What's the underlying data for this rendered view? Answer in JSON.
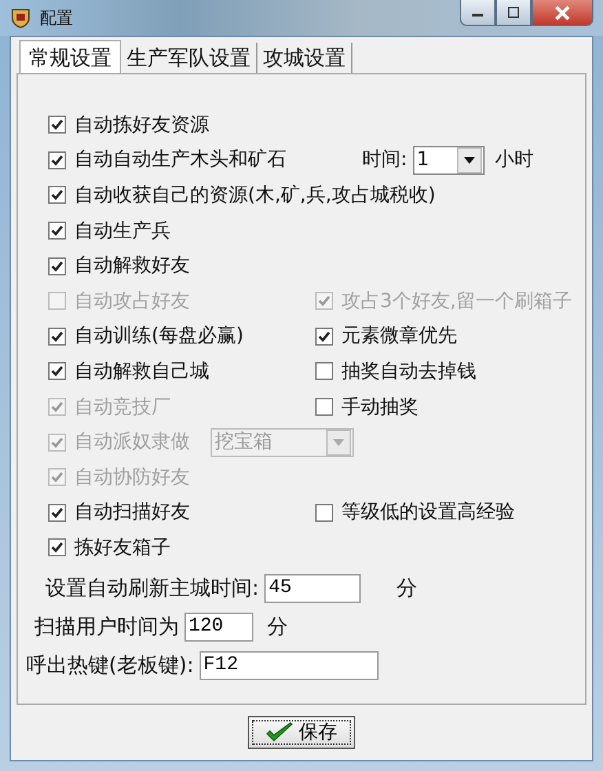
{
  "window": {
    "title": "配置"
  },
  "tabs": [
    {
      "label": "常规设置",
      "selected": true
    },
    {
      "label": "生产军队设置",
      "selected": false
    },
    {
      "label": "攻城设置",
      "selected": false
    }
  ],
  "rows": [
    {
      "items": [
        {
          "kind": "checkbox",
          "label": "自动拣好友资源",
          "checked": true,
          "disabled": false
        }
      ]
    },
    {
      "items": [
        {
          "kind": "checkbox",
          "label": "自动自动生产木头和矿石",
          "checked": true,
          "disabled": false
        },
        {
          "kind": "label",
          "label": "时间:"
        },
        {
          "kind": "select",
          "value": "1",
          "disabled": false
        },
        {
          "kind": "unit",
          "label": "小时"
        }
      ]
    },
    {
      "items": [
        {
          "kind": "checkbox",
          "label": "自动收获自己的资源(木,矿,兵,攻占城税收)",
          "checked": true,
          "disabled": false
        }
      ]
    },
    {
      "items": [
        {
          "kind": "checkbox",
          "label": "自动生产兵",
          "checked": true,
          "disabled": false
        }
      ]
    },
    {
      "items": [
        {
          "kind": "checkbox",
          "label": "自动解救好友",
          "checked": true,
          "disabled": false
        }
      ]
    },
    {
      "items": [
        {
          "kind": "checkbox",
          "label": "自动攻占好友",
          "checked": false,
          "disabled": true
        },
        {
          "kind": "checkbox",
          "label": "攻占3个好友,留一个刷箱子",
          "checked": true,
          "disabled": true
        }
      ]
    },
    {
      "items": [
        {
          "kind": "checkbox",
          "label": "自动训练(每盘必赢)",
          "checked": true,
          "disabled": false
        },
        {
          "kind": "checkbox",
          "label": "元素微章优先",
          "checked": true,
          "disabled": false
        }
      ]
    },
    {
      "items": [
        {
          "kind": "checkbox",
          "label": "自动解救自己城",
          "checked": true,
          "disabled": false
        },
        {
          "kind": "checkbox",
          "label": "抽奖自动去掉钱",
          "checked": false,
          "disabled": false
        }
      ]
    },
    {
      "items": [
        {
          "kind": "checkbox",
          "label": "自动竞技厂",
          "checked": true,
          "disabled": true
        },
        {
          "kind": "checkbox",
          "label": "手动抽奖",
          "checked": false,
          "disabled": false
        }
      ]
    },
    {
      "items": [
        {
          "kind": "checkbox",
          "label": "自动派奴隶做",
          "checked": true,
          "disabled": true
        },
        {
          "kind": "select",
          "value": "挖宝箱",
          "disabled": true
        }
      ]
    },
    {
      "items": [
        {
          "kind": "checkbox",
          "label": "自动协防好友",
          "checked": true,
          "disabled": true
        }
      ]
    },
    {
      "items": [
        {
          "kind": "checkbox",
          "label": "自动扫描好友",
          "checked": true,
          "disabled": false
        },
        {
          "kind": "checkbox",
          "label": "等级低的设置高经验",
          "checked": false,
          "disabled": false
        }
      ]
    },
    {
      "items": [
        {
          "kind": "checkbox",
          "label": "拣好友箱子",
          "checked": true,
          "disabled": false
        }
      ]
    }
  ],
  "fields": [
    {
      "label": "设置自动刷新主城时间:",
      "value": "45",
      "unit": "分"
    },
    {
      "label": "扫描用户时间为",
      "value": "120",
      "unit": "分"
    },
    {
      "label": "呼出热键(老板键):",
      "value": "F12"
    }
  ],
  "save_button": {
    "label": "保存"
  }
}
